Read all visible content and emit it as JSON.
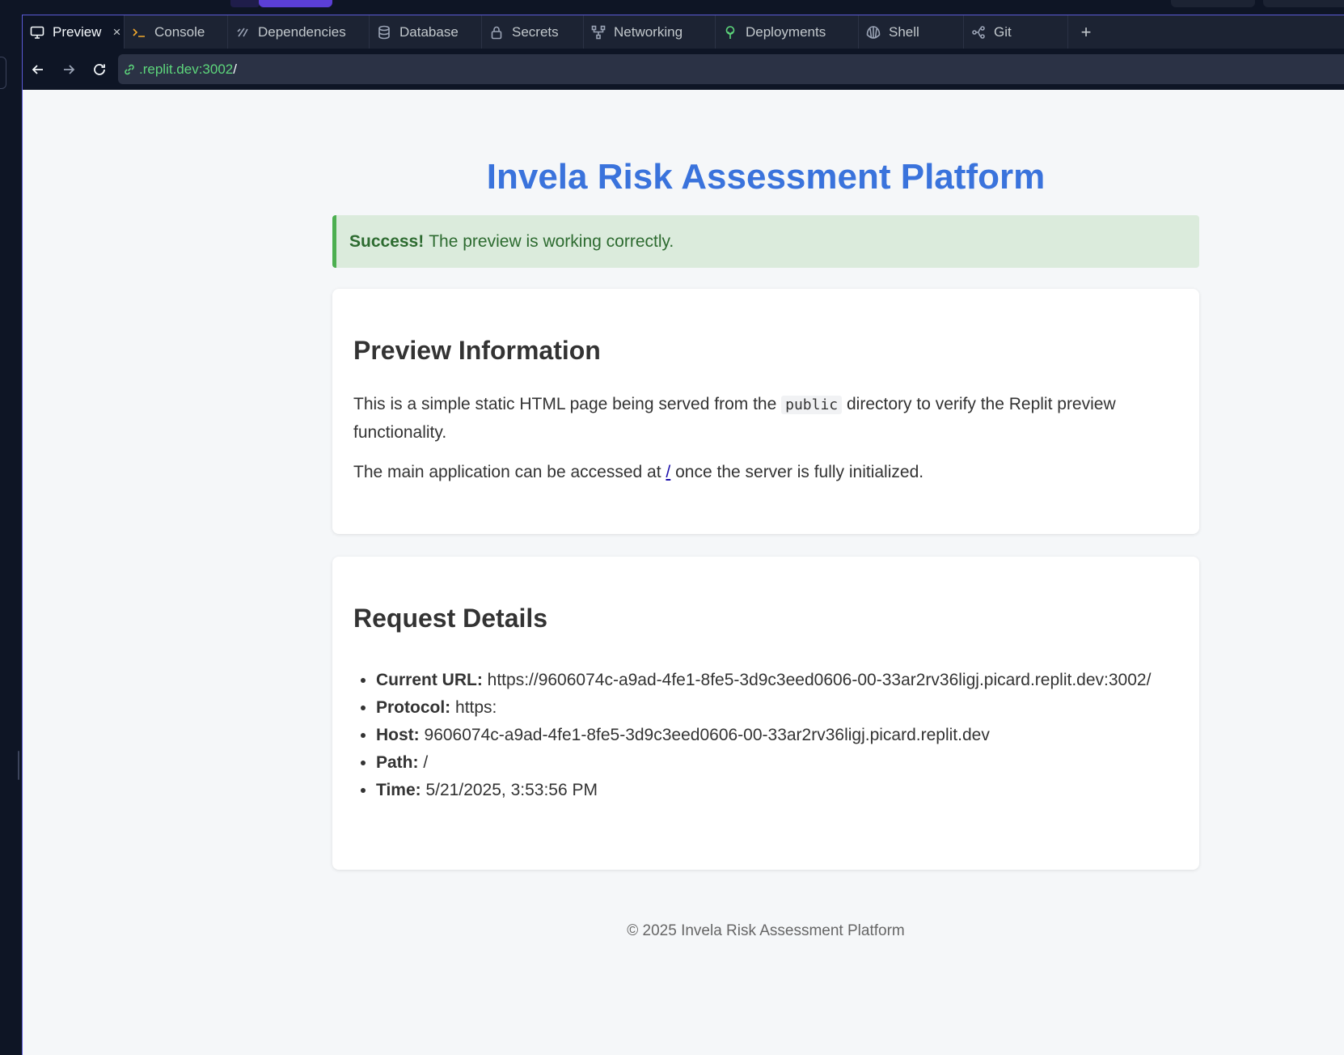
{
  "tabs": [
    {
      "label": "Preview",
      "icon": "monitor-icon",
      "active": true
    },
    {
      "label": "Console",
      "icon": "terminal-prompt-icon"
    },
    {
      "label": "Dependencies",
      "icon": "dependencies-icon"
    },
    {
      "label": "Database",
      "icon": "database-icon"
    },
    {
      "label": "Secrets",
      "icon": "lock-icon"
    },
    {
      "label": "Networking",
      "icon": "network-icon"
    },
    {
      "label": "Deployments",
      "icon": "deploy-icon"
    },
    {
      "label": "Shell",
      "icon": "shell-icon"
    },
    {
      "label": "Git",
      "icon": "git-branch-icon"
    }
  ],
  "tab_close_glyph": "×",
  "tab_add_glyph": "+",
  "url": {
    "host": ".replit.dev:3002",
    "path": "/"
  },
  "page": {
    "title": "Invela Risk Assessment Platform",
    "alert": {
      "strong": "Success!",
      "text": "The preview is working correctly."
    },
    "preview_info": {
      "heading": "Preview Information",
      "p1_before": "This is a simple static HTML page being served from the",
      "p1_code": "public",
      "p1_after": "directory to verify the Replit preview functionality.",
      "p2_before": "The main application can be accessed at",
      "p2_link": "/",
      "p2_after": "once the server is fully initialized."
    },
    "request_details": {
      "heading": "Request Details",
      "items": [
        {
          "label": "Current URL:",
          "value": "https://9606074c-a9ad-4fe1-8fe5-3d9c3eed0606-00-33ar2rv36ligj.picard.replit.dev:3002/"
        },
        {
          "label": "Protocol:",
          "value": "https:"
        },
        {
          "label": "Host:",
          "value": "9606074c-a9ad-4fe1-8fe5-3d9c3eed0606-00-33ar2rv36ligj.picard.replit.dev"
        },
        {
          "label": "Path:",
          "value": "/"
        },
        {
          "label": "Time:",
          "value": "5/21/2025, 3:53:56 PM"
        }
      ]
    },
    "footer": "© 2025 Invela Risk Assessment Platform"
  },
  "colors": {
    "accent": "#3a73dc",
    "success_border": "#4caf50",
    "success_bg": "#dbebdc",
    "url_host": "#5dd67b"
  }
}
